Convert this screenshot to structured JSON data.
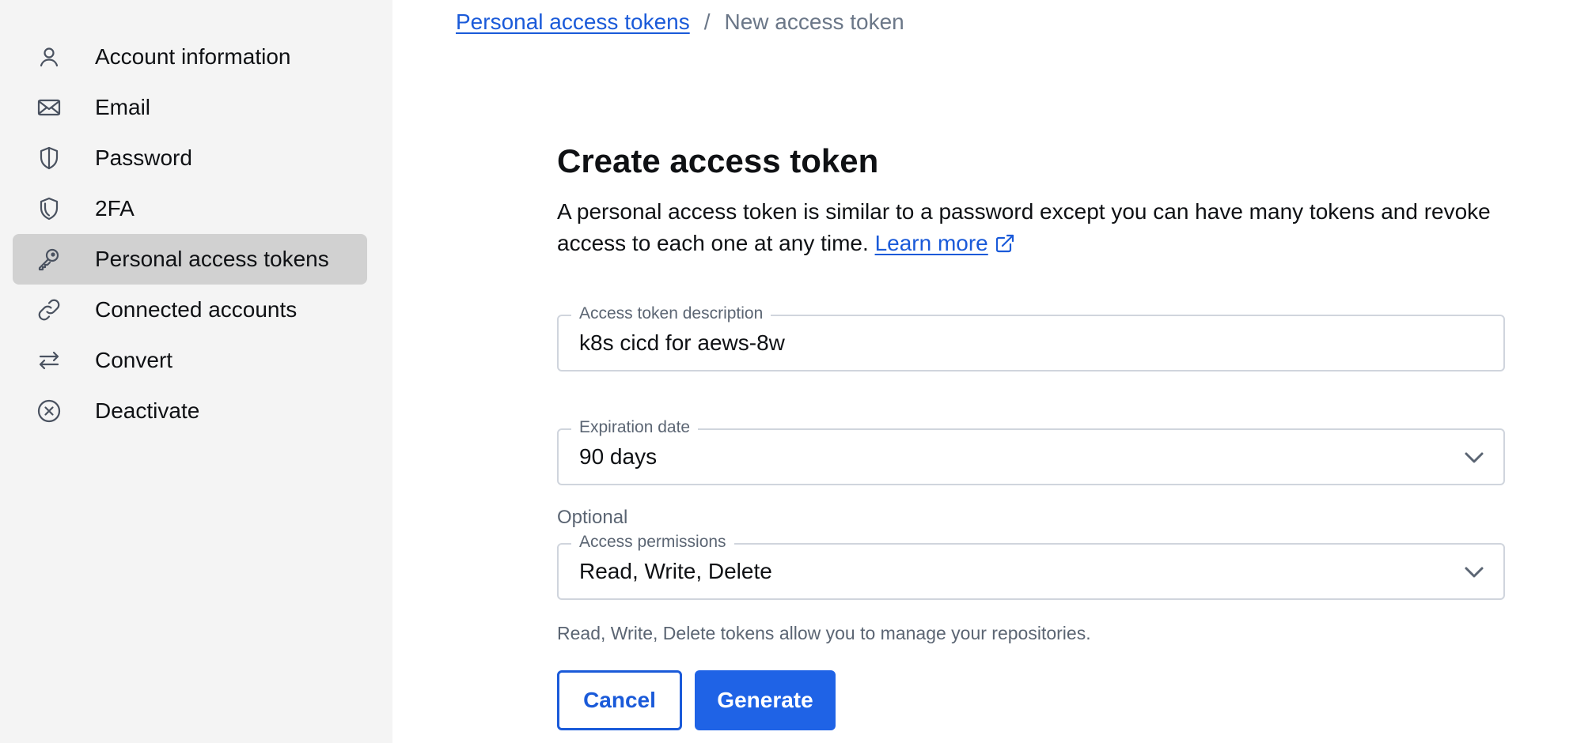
{
  "sidebar": {
    "items": [
      {
        "label": "Account information",
        "icon": "user-icon"
      },
      {
        "label": "Email",
        "icon": "mail-icon"
      },
      {
        "label": "Password",
        "icon": "shield-half-icon"
      },
      {
        "label": "2FA",
        "icon": "shield-double-icon"
      },
      {
        "label": "Personal access tokens",
        "icon": "key-icon",
        "active": true
      },
      {
        "label": "Connected accounts",
        "icon": "link-icon"
      },
      {
        "label": "Convert",
        "icon": "arrows-swap-icon"
      },
      {
        "label": "Deactivate",
        "icon": "x-circle-icon"
      }
    ]
  },
  "breadcrumb": {
    "parent": "Personal access tokens",
    "separator": "/",
    "current": "New access token"
  },
  "form": {
    "title": "Create access token",
    "description": "A personal access token is similar to a password except you can have many tokens and revoke access to each one at any time.",
    "learn_more": "Learn more",
    "description_field": {
      "label": "Access token description",
      "value": "k8s cicd for aews-8w"
    },
    "expiration": {
      "label": "Expiration date",
      "value": "90 days"
    },
    "optional_label": "Optional",
    "permissions": {
      "label": "Access permissions",
      "value": "Read, Write, Delete"
    },
    "helper": "Read, Write, Delete tokens allow you to manage your repositories.",
    "cancel_label": "Cancel",
    "generate_label": "Generate"
  },
  "colors": {
    "accent": "#1f63e6",
    "link": "#1a5ad9",
    "sidebar_bg": "#f4f4f4",
    "active_item_bg": "#d1d1d1"
  }
}
